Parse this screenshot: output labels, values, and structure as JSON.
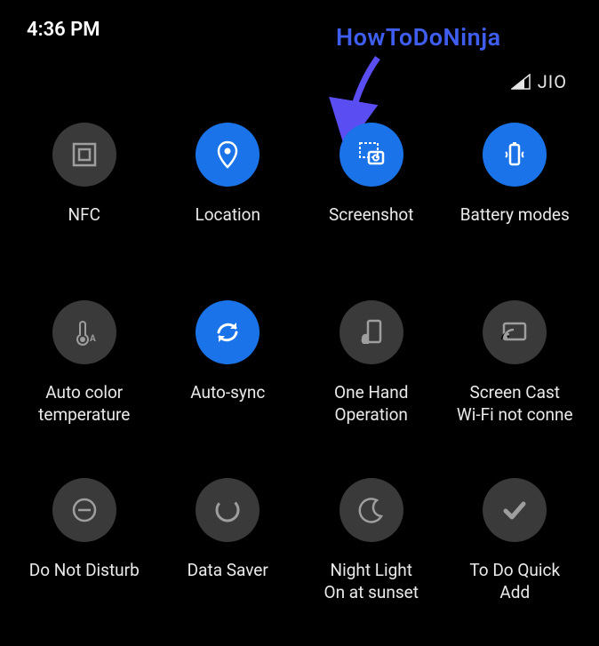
{
  "status": {
    "time": "4:36 PM",
    "carrier": "JIO"
  },
  "annotation": {
    "text": "HowToDoNinja"
  },
  "tiles": [
    {
      "label": "NFC",
      "sublabel": "",
      "active": false,
      "icon": "nfc"
    },
    {
      "label": "Location",
      "sublabel": "",
      "active": true,
      "icon": "location"
    },
    {
      "label": "Screenshot",
      "sublabel": "",
      "active": true,
      "icon": "screenshot"
    },
    {
      "label": "Battery modes",
      "sublabel": "",
      "active": true,
      "icon": "battery"
    },
    {
      "label": "Auto color\ntemperature",
      "sublabel": "",
      "active": false,
      "icon": "thermometer"
    },
    {
      "label": "Auto-sync",
      "sublabel": "",
      "active": true,
      "icon": "sync"
    },
    {
      "label": "One Hand\nOperation",
      "sublabel": "",
      "active": false,
      "icon": "onehand"
    },
    {
      "label": "Screen Cast",
      "sublabel": "Wi-Fi not conne",
      "active": false,
      "icon": "cast"
    },
    {
      "label": "Do Not Disturb",
      "sublabel": "",
      "active": false,
      "icon": "dnd"
    },
    {
      "label": "Data Saver",
      "sublabel": "",
      "active": false,
      "icon": "datasaver"
    },
    {
      "label": "Night Light",
      "sublabel": "On at sunset",
      "active": false,
      "icon": "nightlight"
    },
    {
      "label": "To Do Quick\nAdd",
      "sublabel": "",
      "active": false,
      "icon": "todo"
    }
  ]
}
